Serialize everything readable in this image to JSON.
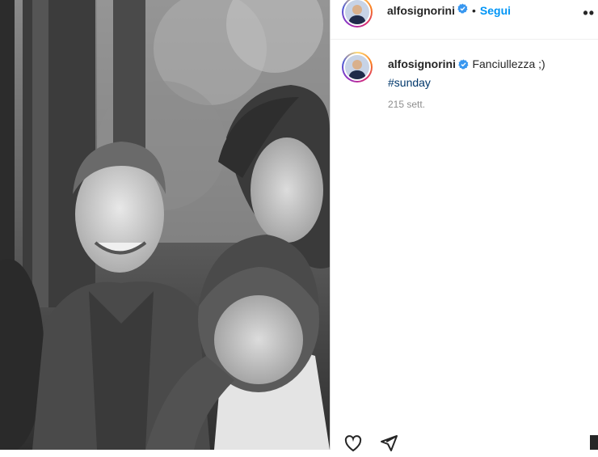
{
  "post": {
    "username": "alfosignorini",
    "follow_label": "Segui",
    "dot": "•",
    "more_label": "••",
    "caption": {
      "username": "alfosignorini",
      "text": "Fanciullezza ;)",
      "hashtag": "#sunday",
      "time": "215 sett."
    }
  },
  "colors": {
    "accent": "#0095f6",
    "verified": "#3897f0",
    "hashtag": "#00376b",
    "muted": "#8e8e8e"
  },
  "icons": {
    "verified": "verified-badge-icon",
    "like": "heart-icon",
    "share": "send-icon",
    "save": "bookmark-icon"
  },
  "image": {
    "alt": "Black and white photo"
  }
}
